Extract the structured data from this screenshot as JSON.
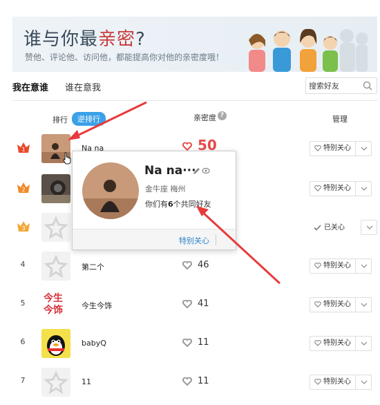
{
  "banner": {
    "title_pre": "谁与你最",
    "title_hl": "亲密",
    "title_post": "?",
    "subtitle": "赞他、评论他、访问他，都能提高你对他的亲密度哦！"
  },
  "tabs": {
    "active": "我在意谁",
    "other": "谁在意我"
  },
  "search": {
    "placeholder": "搜索好友"
  },
  "header": {
    "rank": "排行",
    "toggle": "逆排行",
    "intimacy": "亲密度",
    "help": "?",
    "manage": "管理"
  },
  "rows": [
    {
      "rank": "1",
      "name": "Na na",
      "score": "50",
      "action": "特别关心"
    },
    {
      "rank": "2",
      "name": "",
      "score": "",
      "action": "特别关心"
    },
    {
      "rank": "3",
      "name": "",
      "score": "",
      "action": "已关心"
    },
    {
      "rank": "4",
      "name": "第二个",
      "score": "46",
      "action": "特别关心"
    },
    {
      "rank": "5",
      "name": "今生今饰",
      "score": "41",
      "action": "特别关心"
    },
    {
      "rank": "6",
      "name": "babyQ",
      "score": "11",
      "action": "特别关心"
    },
    {
      "rank": "7",
      "name": "11",
      "score": "11",
      "action": "特别关心"
    }
  ],
  "avatar5_text": [
    "今生",
    "今饰"
  ],
  "popup": {
    "name": "Na na···",
    "info": "金牛座 梅州",
    "common_pre": "你们有",
    "common_num": "6",
    "common_post": "个共同好友",
    "follow": "特别关心"
  },
  "colors": {
    "accent": "#3aa0e8",
    "heart_red": "#e64a4a",
    "crown_red": "#e84a2a",
    "crown_orange": "#f08a2a",
    "arrow": "#e83a3a"
  }
}
